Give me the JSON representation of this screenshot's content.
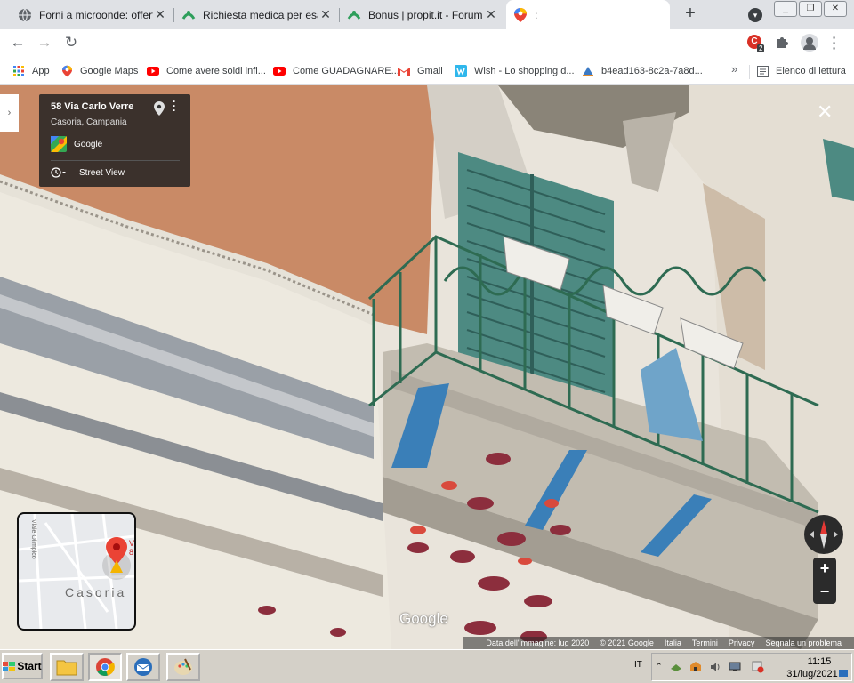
{
  "tabs": [
    {
      "title": "Forni a microonde: offerte e",
      "close": "✕"
    },
    {
      "title": "Richiesta medica per esame",
      "close": "✕"
    },
    {
      "title": "Bonus | propit.it - Forum pe",
      "close": "✕"
    },
    {
      "title": ":",
      "close": ""
    }
  ],
  "newtab": "+",
  "window_buttons": {
    "minimize": "_",
    "restore": "❐",
    "close": "✕"
  },
  "toolbar": {
    "back": "←",
    "forward": "→",
    "reload": "↻",
    "extension_badge": "2"
  },
  "bookmarks": [
    {
      "label": "App",
      "icon": "apps-grid-icon"
    },
    {
      "label": "Google Maps",
      "icon": "maps-pin-icon"
    },
    {
      "label": "Come avere soldi infi...",
      "icon": "youtube-icon"
    },
    {
      "label": "Come GUADAGNARE...",
      "icon": "youtube-icon"
    },
    {
      "label": "Gmail",
      "icon": "gmail-icon"
    },
    {
      "label": "Wish - Lo shopping d...",
      "icon": "wish-icon"
    },
    {
      "label": "b4ead163-8c2a-7a8d...",
      "icon": "page-icon"
    }
  ],
  "bookmarks_more": "»",
  "reading_list": "Elenco di lettura",
  "streetview": {
    "address": "58 Via Carlo Verre",
    "locality": "Casoria, Campania",
    "provider": "Google",
    "mode": "Street View",
    "watermark": "Google",
    "minimap_city": "Casoria",
    "minimap_road": "Viale Olimpico",
    "minimap_label": "V 8",
    "footer": [
      "Data dell'immagine: lug 2020",
      "© 2021 Google",
      "Italia",
      "Termini",
      "Privacy",
      "Segnala un problema"
    ],
    "zoom_in": "+",
    "zoom_out": "−"
  },
  "taskbar": {
    "start": "Start",
    "language": "IT",
    "time": "11:15",
    "date": "31/lug/2021"
  }
}
